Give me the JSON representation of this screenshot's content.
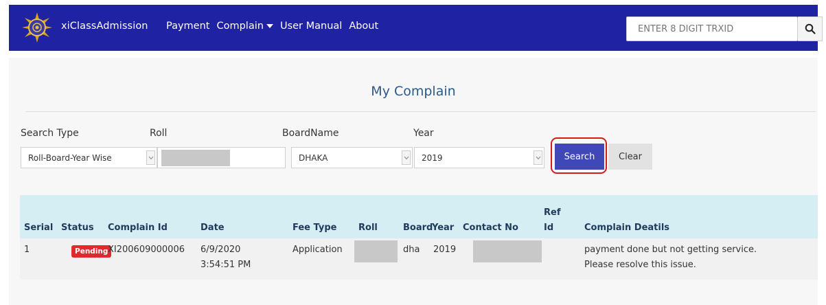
{
  "navbar": {
    "brand": "xiClassAdmission",
    "links": [
      "Payment",
      "Complain",
      "User Manual",
      "About"
    ],
    "search_placeholder": "ENTER 8 DIGIT TRXID",
    "bg_color": "#1e22a3"
  },
  "page": {
    "title": "My Complain"
  },
  "form": {
    "search_type_label": "Search Type",
    "search_type_value": "Roll-Board-Year Wise",
    "roll_label": "Roll",
    "roll_value": "",
    "board_label": "BoardName",
    "board_value": "DHAKA",
    "year_label": "Year",
    "year_value": "2019",
    "search_button": "Search",
    "clear_button": "Clear"
  },
  "table": {
    "headers": [
      "Serial",
      "Status",
      "Complain Id",
      "Date",
      "Fee Type",
      "Roll",
      "Board",
      "Year",
      "Contact No",
      "Ref Id",
      "Complain Deatils"
    ],
    "ref_header_line1": "Ref",
    "ref_header_line2": "Id",
    "rows": [
      {
        "serial": "1",
        "status": "Pending",
        "complain_id": "XI200609000006",
        "date_line1": "6/9/2020",
        "date_line2": "3:54:51 PM",
        "fee_type": "Application",
        "roll": "",
        "board": "dha",
        "year": "2019",
        "contact_no": "",
        "ref_id": "",
        "details_line1": "payment done but not getting service.",
        "details_line2": "Please resolve this issue."
      }
    ]
  }
}
